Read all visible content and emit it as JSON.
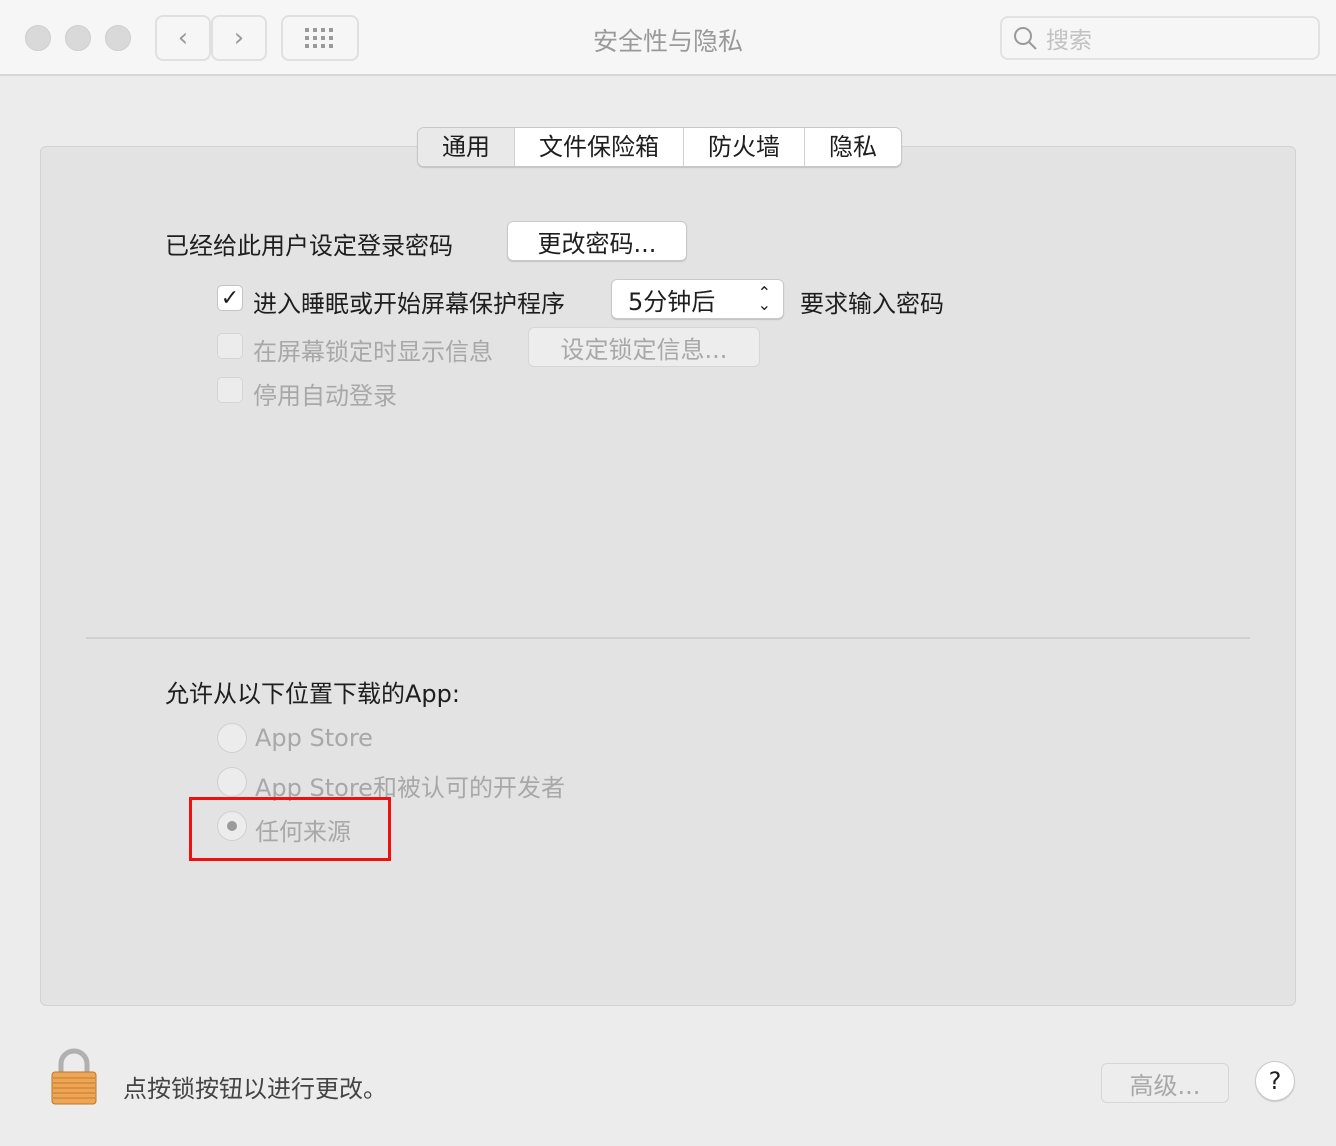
{
  "window": {
    "title": "安全性与隐私",
    "search_placeholder": "搜索"
  },
  "tabs": [
    {
      "label": "通用",
      "selected": true
    },
    {
      "label": "文件保险箱"
    },
    {
      "label": "防火墙"
    },
    {
      "label": "隐私"
    }
  ],
  "general": {
    "password_label": "已经给此用户设定登录密码",
    "change_password_button": "更改密码...",
    "require_password": {
      "checked": true,
      "label": "进入睡眠或开始屏幕保护程序",
      "delay_value": "5分钟后",
      "suffix": "要求输入密码"
    },
    "show_message": {
      "checked": false,
      "label": "在屏幕锁定时显示信息",
      "button": "设定锁定信息..."
    },
    "disable_autologin": {
      "checked": false,
      "label": "停用自动登录"
    },
    "allow_apps_label": "允许从以下位置下载的App:",
    "radio_options": [
      {
        "label": "App Store",
        "selected": false
      },
      {
        "label": "App Store和被认可的开发者",
        "selected": false
      },
      {
        "label": "任何来源",
        "selected": true
      }
    ]
  },
  "footer": {
    "lock_text": "点按锁按钮以进行更改。",
    "advanced_button": "高级...",
    "help_button": "?"
  },
  "colors": {
    "highlight": "#f01010"
  }
}
